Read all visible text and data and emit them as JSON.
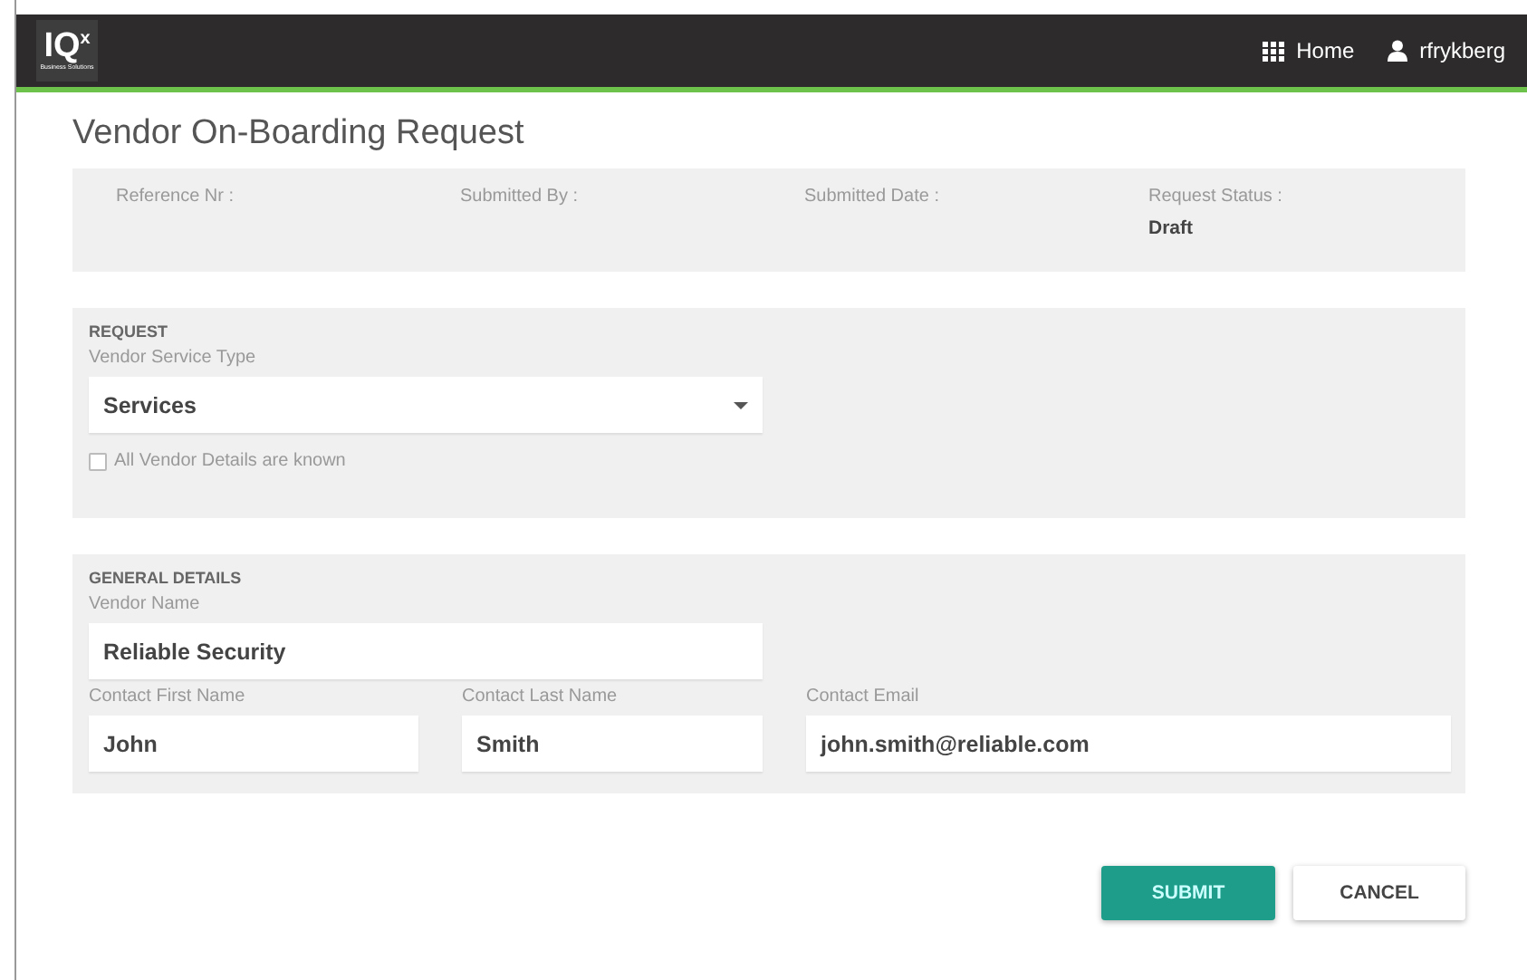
{
  "header": {
    "logo": {
      "main": "IQ",
      "sup": "x",
      "sub": "Business Solutions"
    },
    "nav": [
      {
        "kind": "grid",
        "label": "Home"
      },
      {
        "kind": "user",
        "label": "rfrykberg"
      }
    ]
  },
  "title": "Vendor On-Boarding Request",
  "info": [
    {
      "label": "Reference Nr :"
    },
    {
      "label": "Submitted By :"
    },
    {
      "label": "Submitted Date :"
    },
    {
      "label": "Request Status :",
      "value": "Draft"
    }
  ],
  "sections": [
    {
      "heading": "REQUEST",
      "rows": [
        [
          {
            "kind": "select",
            "label": "Vendor Service Type",
            "value": "Services"
          }
        ],
        [
          {
            "kind": "checkbox",
            "label": "All Vendor Details are known",
            "checked": false
          }
        ]
      ]
    },
    {
      "heading": "GENERAL DETAILS",
      "rows": [
        [
          {
            "kind": "text",
            "label": "Vendor Name",
            "value": "Reliable Security"
          }
        ],
        [
          {
            "kind": "text",
            "label": "Contact First Name",
            "value": "John"
          },
          {
            "kind": "text",
            "label": "Contact Last Name",
            "value": "Smith"
          },
          {
            "kind": "text",
            "label": "Contact Email",
            "value": "john.smith@reliable.com"
          }
        ]
      ]
    }
  ],
  "buttons": [
    {
      "kind": "primary",
      "label": "SUBMIT"
    },
    {
      "kind": "secondary",
      "label": "CANCEL"
    }
  ]
}
